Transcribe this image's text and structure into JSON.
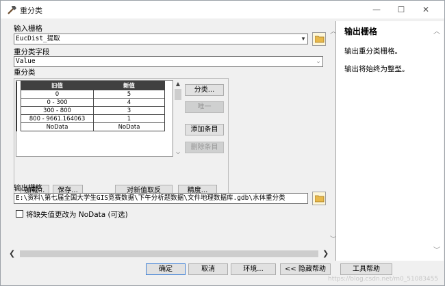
{
  "window": {
    "title": "重分类",
    "minimize": "—",
    "maximize": "☐",
    "close": "✕"
  },
  "input_raster": {
    "label": "输入栅格",
    "value": "EucDist_提取"
  },
  "reclass_field": {
    "label": "重分类字段",
    "value": "Value"
  },
  "reclass": {
    "label": "重分类",
    "columns": [
      "旧值",
      "新值"
    ],
    "rows": [
      {
        "old": "0",
        "new": "5"
      },
      {
        "old": "0 - 300",
        "new": "4"
      },
      {
        "old": "300 - 800",
        "new": "3"
      },
      {
        "old": "800 - 9661.164063",
        "new": "1"
      },
      {
        "old": "NoData",
        "new": "NoData"
      }
    ],
    "buttons": {
      "classify": "分类...",
      "unique": "唯一",
      "add_entry": "添加条目",
      "delete_entry": "删除条目",
      "load": "加载...",
      "save": "保存...",
      "reverse": "对新值取反",
      "precision": "精度..."
    }
  },
  "output_raster": {
    "label": "输出栅格",
    "value": "E:\\资料\\第七届全国大学生GIS竞赛数据\\下午分析题数据\\文件地理数据库.gdb\\水体重分类"
  },
  "missing_nodata": {
    "label": "将缺失值更改为 NoData (可选)",
    "checked": false
  },
  "help": {
    "title": "输出栅格",
    "p1": "输出重分类栅格。",
    "p2": "输出将始终为整型。"
  },
  "footer": {
    "ok": "确定",
    "cancel": "取消",
    "env": "环境...",
    "hide_help": "<< 隐藏帮助",
    "tool_help": "工具帮助"
  },
  "watermark": "https://blog.csdn.net/m0_51083455"
}
